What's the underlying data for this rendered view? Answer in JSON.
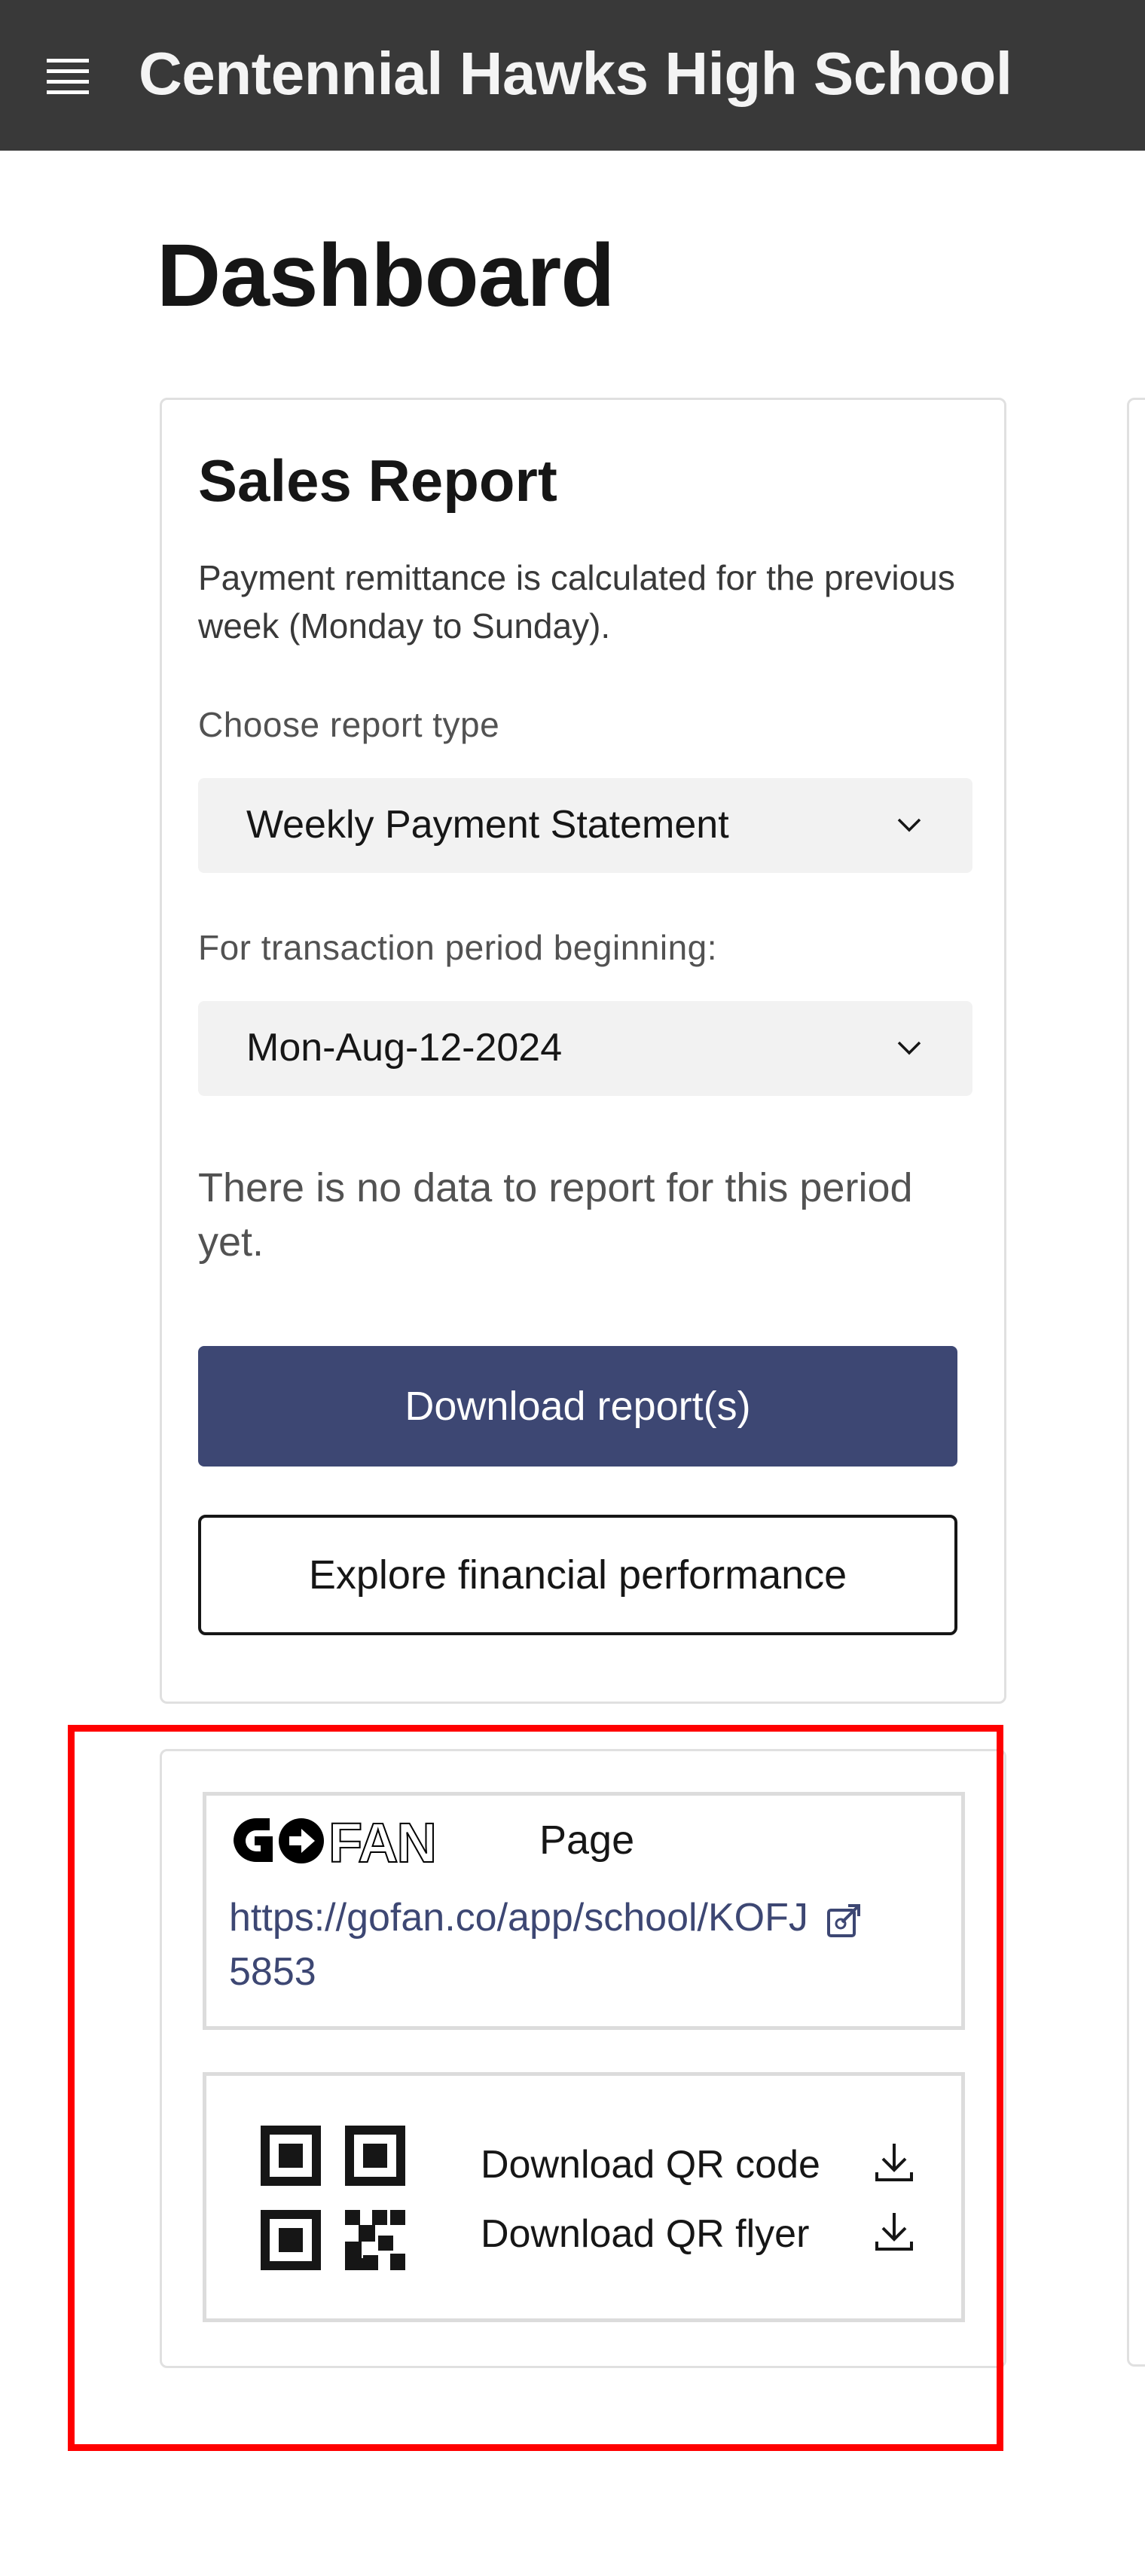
{
  "header": {
    "app_title": "Centennial Hawks High School",
    "menu_icon": "hamburger-menu-icon"
  },
  "page": {
    "title": "Dashboard"
  },
  "sales_report": {
    "title": "Sales Report",
    "description": "Payment remittance is calculated for the previous week (Monday to Sunday).",
    "report_type_label": "Choose report type",
    "report_type_value": "Weekly Payment Statement",
    "period_label": "For transaction period beginning:",
    "period_value": "Mon-Aug-12-2024",
    "no_data_message": "There is no data to report for this period yet.",
    "download_button_label": "Download report(s)",
    "explore_button_label": "Explore financial performance"
  },
  "gofan": {
    "logo_text": "GOFAN",
    "page_label": "Page",
    "url": "https://gofan.co/app/school/KOFJ5853",
    "copy_icon": "copy-link-icon",
    "qr_icon": "qr-code-icon",
    "download_qr_code_label": "Download QR code",
    "download_qr_flyer_label": "Download QR flyer",
    "download_icon": "download-icon"
  },
  "colors": {
    "header_bg": "#393939",
    "primary_button": "#3d4773",
    "link": "#3d4773",
    "highlight": "#ff0000"
  }
}
